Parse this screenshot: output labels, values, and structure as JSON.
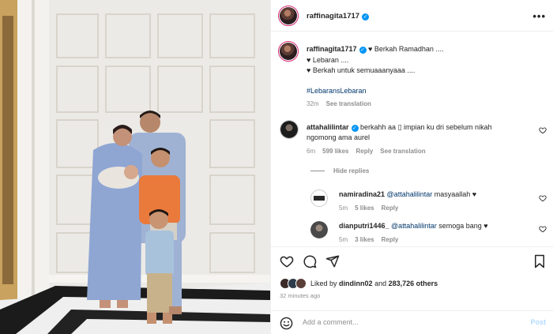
{
  "header": {
    "username": "raffinagita1717",
    "more_icon": "more-horizontal-icon"
  },
  "caption": {
    "username": "raffinagita1717",
    "line1": "♥ Berkah Ramadhan ....",
    "line2": "♥ Lebaran ....",
    "line3": "♥ Berkah untuk semuaaanyaaa ....",
    "hashtag": "#LebaransLebaran",
    "time": "32m",
    "see_translation": "See translation"
  },
  "comments": [
    {
      "username": "attahalilintar",
      "verified": true,
      "text1": "berkahh aa ▯ impian ku dri sebelum nikah",
      "text2": "ngomong ama aurel",
      "time": "6m",
      "likes": "599 likes",
      "reply": "Reply",
      "see_translation": "See translation"
    }
  ],
  "hide_replies": "Hide replies",
  "replies": [
    {
      "username": "namiradina21",
      "mention": "@attahalilintar",
      "text": "masyaallah ♥",
      "time": "5m",
      "likes": "5 likes",
      "reply": "Reply"
    },
    {
      "username": "dianputri1446_",
      "mention": "@attahalilintar",
      "text": "semoga bang ♥",
      "time": "5m",
      "likes": "3 likes",
      "reply": "Reply"
    }
  ],
  "likes": {
    "prefix": "Liked by",
    "user": "dindinn02",
    "conj": "and",
    "count": "283,726 others"
  },
  "timestamp": "32 minutes ago",
  "comment_box": {
    "placeholder": "Add a comment...",
    "post": "Post"
  },
  "colors": {
    "link": "#00376b",
    "verified": "#0095f6",
    "muted": "#8e8e8e",
    "post_disabled": "#b3dbff"
  }
}
